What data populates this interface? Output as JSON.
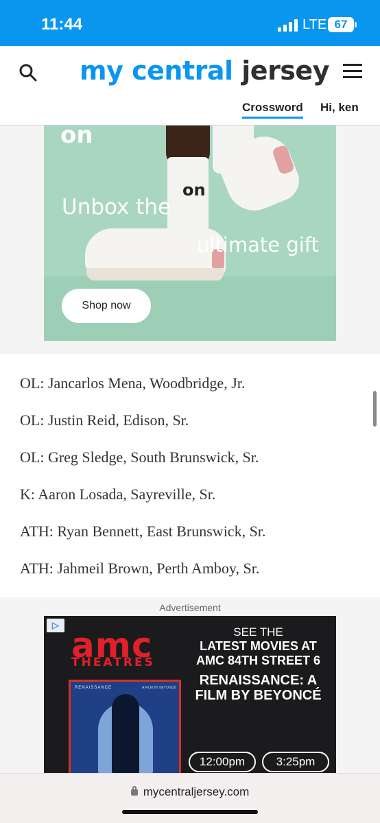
{
  "status_bar": {
    "time": "11:44",
    "network": "LTE",
    "battery": "67"
  },
  "header": {
    "logo_part1": "my central",
    "logo_part2": "jersey",
    "crossword_label": "Crossword",
    "greeting": "Hi, ken",
    "accent_color": "#0a96ef"
  },
  "ad_top": {
    "brand_mark": "on",
    "sock_logo": "on",
    "line1": "Unbox the",
    "line2": "ultimate gift",
    "cta": "Shop now"
  },
  "article": {
    "players": [
      "OL: Jancarlos Mena, Woodbridge, Jr.",
      "OL: Justin Reid, Edison, Sr.",
      "OL: Greg Sledge, South Brunswick, Sr.",
      "K: Aaron Losada, Sayreville, Sr.",
      "ATH: Ryan Bennett, East Brunswick, Sr.",
      "ATH: Jahmeil Brown, Perth Amboy, Sr."
    ]
  },
  "ad_amc": {
    "label": "Advertisement",
    "adchoices_icon": "adchoices-icon",
    "logo": "amc",
    "logo_sub": "THEATRES",
    "poster_title": "RENAISSANCE",
    "poster_subtitle": "A FILM BY BEYONCÉ",
    "see_the": "SEE THE",
    "headline": "LATEST MOVIES AT AMC 84TH STREET 6",
    "movie": "RENAISSANCE: A FILM BY BEYONCÉ",
    "showtimes": [
      "12:00pm",
      "3:25pm"
    ]
  },
  "browser": {
    "url": "mycentraljersey.com"
  }
}
